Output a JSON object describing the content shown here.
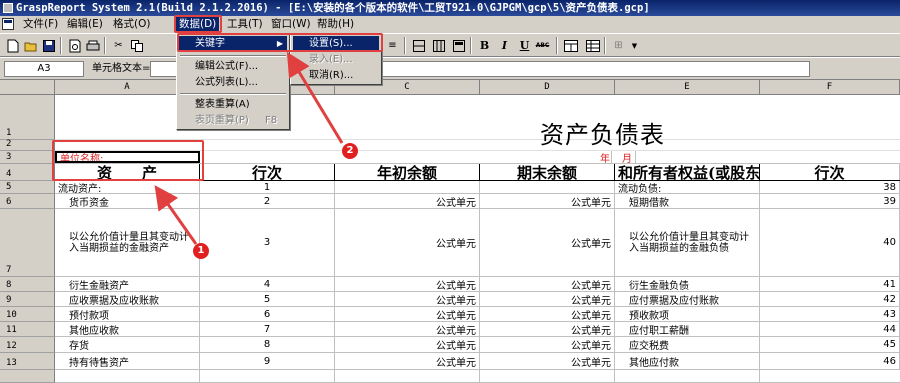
{
  "window": {
    "title": "GraspReport System 2.1(Build 2.1.2.2016) - [E:\\安装的各个版本的软件\\工贸T921.0\\GJPGM\\gcp\\5\\资产负债表.gcp]"
  },
  "menubar": {
    "items": [
      "文件(F)",
      "编辑(E)",
      "格式(O)",
      "数据(D)",
      "工具(T)",
      "窗口(W)",
      "帮助(H)"
    ]
  },
  "toolbar": {
    "bold": "B",
    "italic": "I",
    "underline": "U",
    "strike": "ABC"
  },
  "formula_bar": {
    "cell_ref": "A3",
    "label": "单元格文本=",
    "value": ""
  },
  "data_menu": {
    "items": [
      {
        "label": "关键字",
        "state": "highlight"
      },
      {
        "label": "编辑公式(F)...",
        "state": "normal"
      },
      {
        "label": "公式列表(L)...",
        "state": "normal"
      },
      {
        "label": "整表重算(A)",
        "state": "normal"
      },
      {
        "label": "表页重算(P)",
        "shortcut": "F8",
        "state": "disabled"
      }
    ]
  },
  "keyword_submenu": {
    "items": [
      {
        "label": "设置(S)...",
        "state": "highlight"
      },
      {
        "label": "录入(E)...",
        "state": "disabled"
      },
      {
        "label": "取消(R)...",
        "state": "normal"
      }
    ]
  },
  "columns": [
    "A",
    "B",
    "C",
    "D",
    "E",
    "F"
  ],
  "sheet": {
    "title": "资产负债表",
    "unit_label": "单位名称:",
    "year_label": "年",
    "month_label": "月",
    "header": {
      "a": "资　　产",
      "b": "行次",
      "c": "年初余额",
      "d": "期末余额",
      "e": "和所有者权益(或股东权",
      "f": "行次"
    },
    "rows": [
      {
        "num": "5",
        "a": "流动资产:",
        "b": "1",
        "c": "",
        "d": "",
        "e": "流动负债:",
        "f": "38"
      },
      {
        "num": "6",
        "a": "货币资金",
        "b": "2",
        "c": "公式单元",
        "d": "公式单元",
        "e": "短期借款",
        "f": "39"
      },
      {
        "num": "7",
        "a": "以公允价值计量且其变动计入当期损益的金融资产",
        "b": "3",
        "c": "公式单元",
        "d": "公式单元",
        "e": "以公允价值计量且其变动计入当期损益的金融负债",
        "f": "40"
      },
      {
        "num": "8",
        "a": "衍生金融资产",
        "b": "4",
        "c": "公式单元",
        "d": "公式单元",
        "e": "衍生金融负债",
        "f": "41"
      },
      {
        "num": "9",
        "a": "应收票据及应收账款",
        "b": "5",
        "c": "公式单元",
        "d": "公式单元",
        "e": "应付票据及应付账款",
        "f": "42"
      },
      {
        "num": "10",
        "a": "预付款项",
        "b": "6",
        "c": "公式单元",
        "d": "公式单元",
        "e": "预收款项",
        "f": "43"
      },
      {
        "num": "11",
        "a": "其他应收款",
        "b": "7",
        "c": "公式单元",
        "d": "公式单元",
        "e": "应付职工薪酬",
        "f": "44"
      },
      {
        "num": "12",
        "a": "存货",
        "b": "8",
        "c": "公式单元",
        "d": "公式单元",
        "e": "应交税费",
        "f": "45"
      },
      {
        "num": "13",
        "a": "持有待售资产",
        "b": "9",
        "c": "公式单元",
        "d": "公式单元",
        "e": "其他应付款",
        "f": "46"
      }
    ]
  },
  "annotations": {
    "badge1": "1",
    "badge2": "2"
  },
  "colors": {
    "annotation": "#e04040",
    "highlight": "#0a246a",
    "chrome": "#d4d0c8"
  }
}
